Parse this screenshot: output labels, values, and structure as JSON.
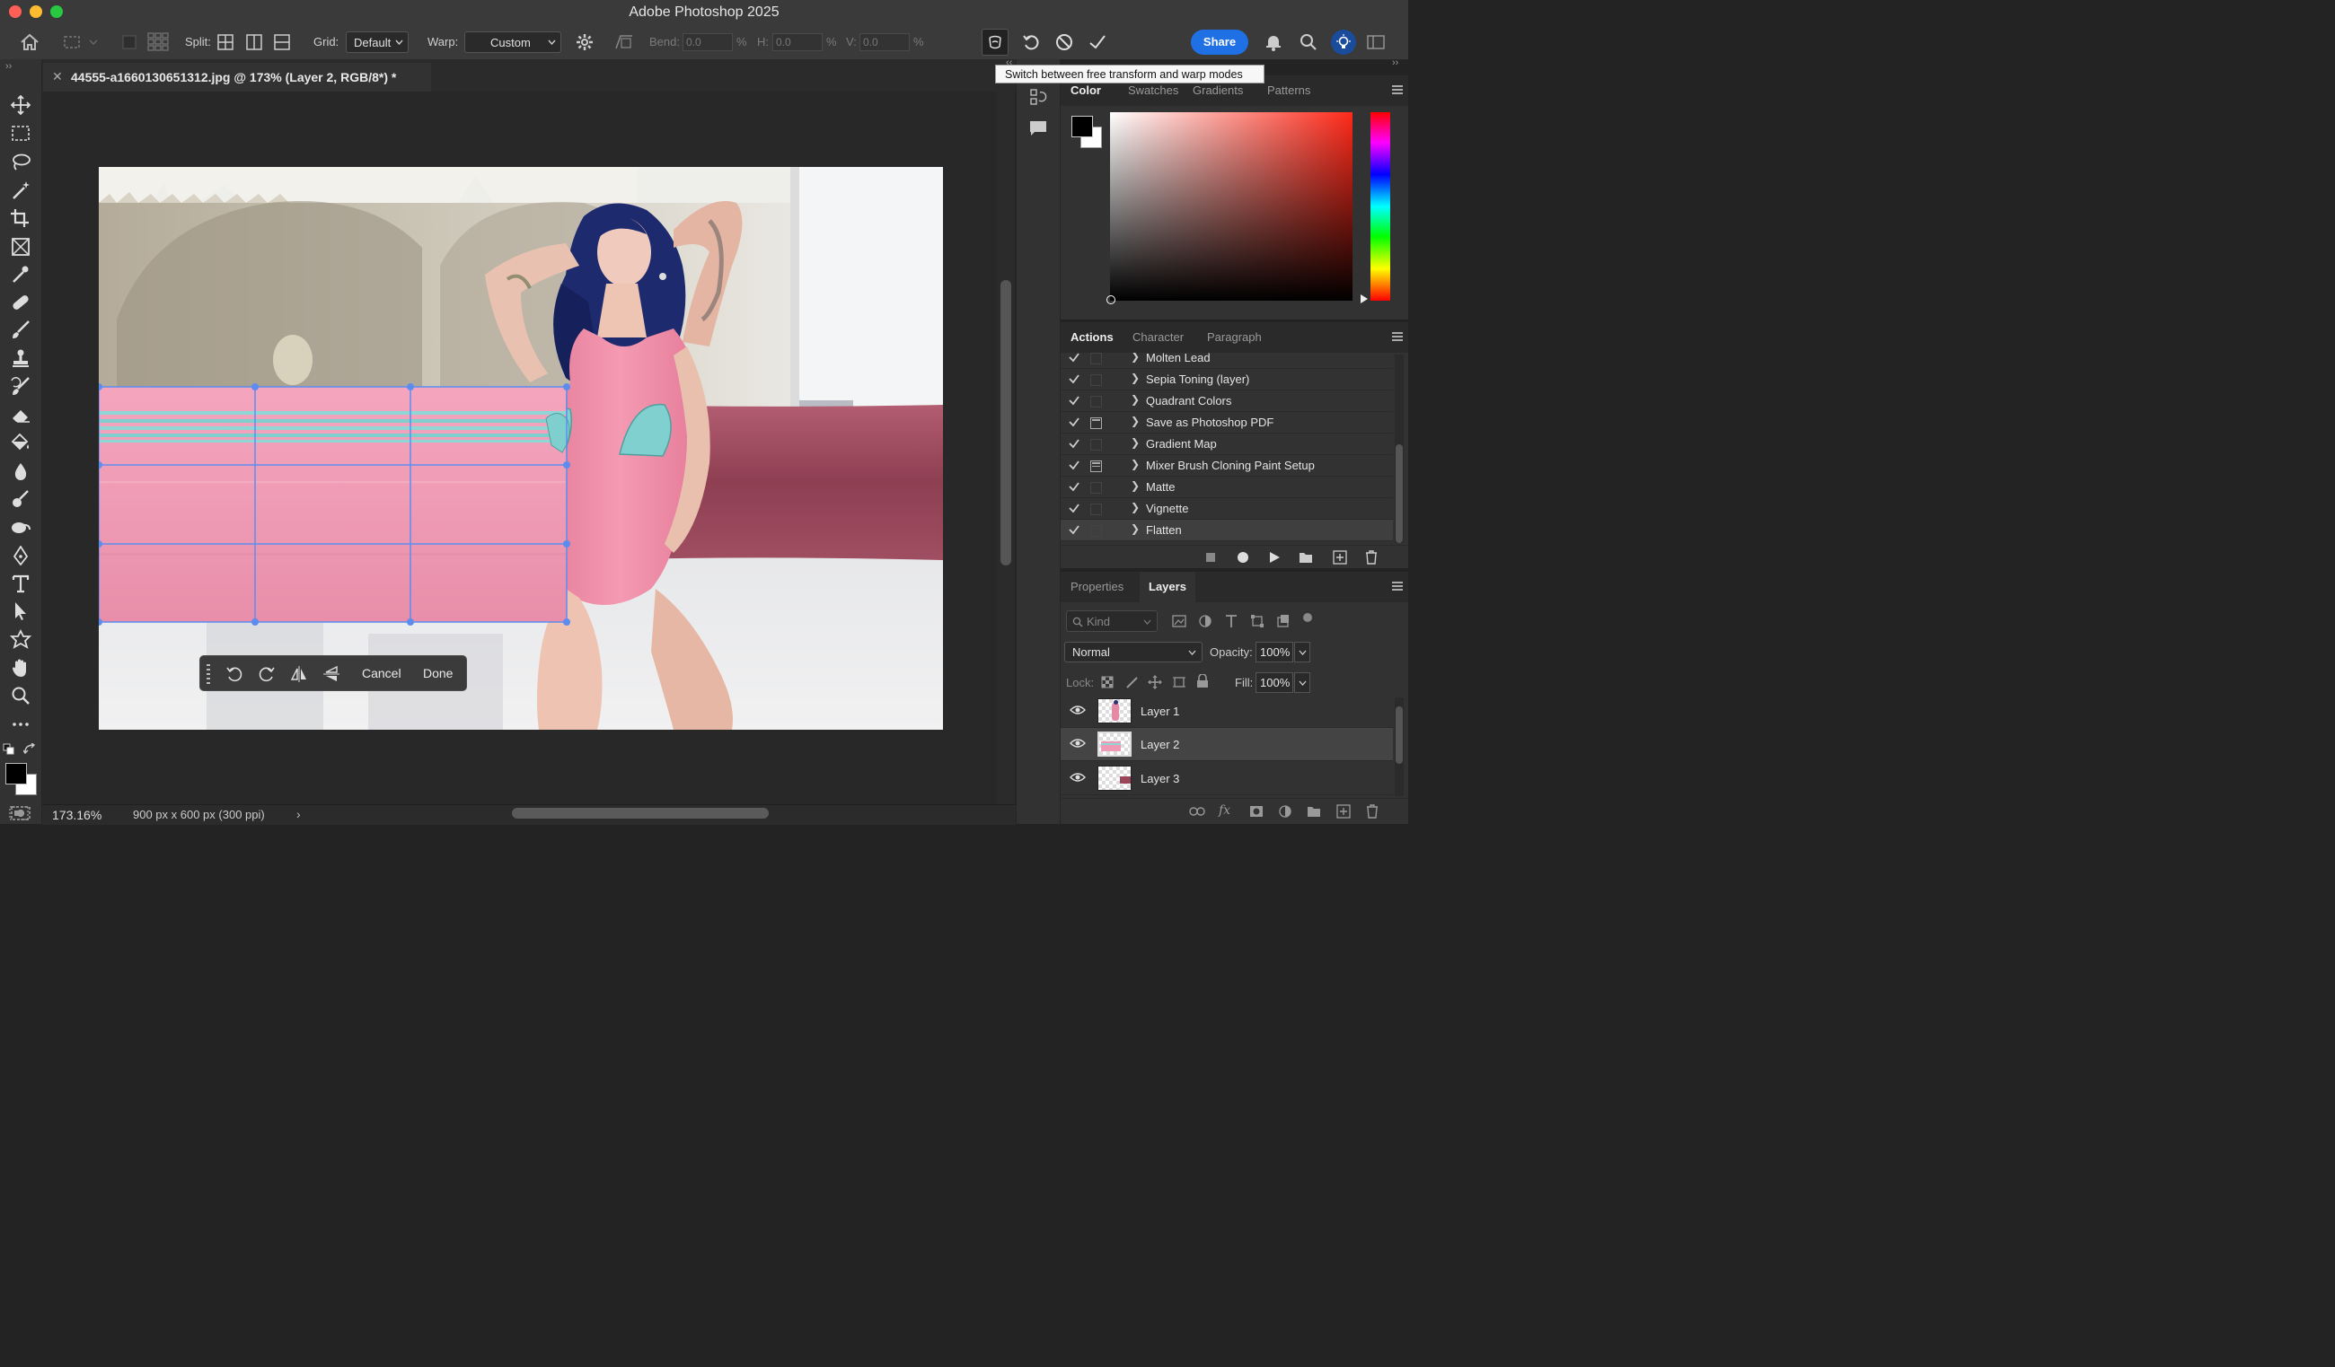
{
  "window": {
    "title": "Adobe Photoshop 2025",
    "traffic_colors": [
      "#fe5f57",
      "#febc2e",
      "#28c840"
    ]
  },
  "options_bar": {
    "split_label": "Split:",
    "grid_label": "Grid:",
    "grid_value": "Default",
    "warp_label": "Warp:",
    "warp_value": "Custom",
    "bend_label": "Bend:",
    "bend_value": "0.0",
    "h_label": "H:",
    "h_value": "0.0",
    "v_label": "V:",
    "v_value": "0.0",
    "percent": "%",
    "share_label": "Share",
    "accent": "#1f6fe5"
  },
  "tooltip": {
    "text": "Switch between free transform and warp modes"
  },
  "document": {
    "tab_title": "44555-a1660130651312.jpg @ 173% (Layer 2, RGB/8*) *",
    "zoom": "173.16%",
    "doc_info": "900 px x 600 px (300 ppi)"
  },
  "floating_bar": {
    "cancel_label": "Cancel",
    "done_label": "Done"
  },
  "color_panel": {
    "tabs": [
      "Color",
      "Swatches",
      "Gradients",
      "Patterns"
    ],
    "active_tab": "Color",
    "hue_color": "#ff2a1a"
  },
  "actions_panel": {
    "tabs": [
      "Actions",
      "Character",
      "Paragraph"
    ],
    "items": [
      {
        "name": "Molten Lead",
        "has_dialog": false
      },
      {
        "name": "Sepia Toning (layer)",
        "has_dialog": false
      },
      {
        "name": "Quadrant Colors",
        "has_dialog": false
      },
      {
        "name": "Save as Photoshop PDF",
        "has_dialog": true
      },
      {
        "name": "Gradient Map",
        "has_dialog": false
      },
      {
        "name": "Mixer Brush Cloning Paint Setup",
        "has_dialog": true
      },
      {
        "name": "Matte",
        "has_dialog": false
      },
      {
        "name": "Vignette",
        "has_dialog": false
      },
      {
        "name": "Flatten",
        "has_dialog": false
      }
    ]
  },
  "layers_panel": {
    "tabs": [
      "Properties",
      "Layers"
    ],
    "kind_placeholder": "Kind",
    "blend_mode": "Normal",
    "opacity_label": "Opacity:",
    "opacity_value": "100%",
    "lock_label": "Lock:",
    "fill_label": "Fill:",
    "fill_value": "100%",
    "layers": [
      {
        "name": "Layer 1",
        "selected": false
      },
      {
        "name": "Layer 2",
        "selected": true
      },
      {
        "name": "Layer 3",
        "selected": false
      }
    ]
  }
}
